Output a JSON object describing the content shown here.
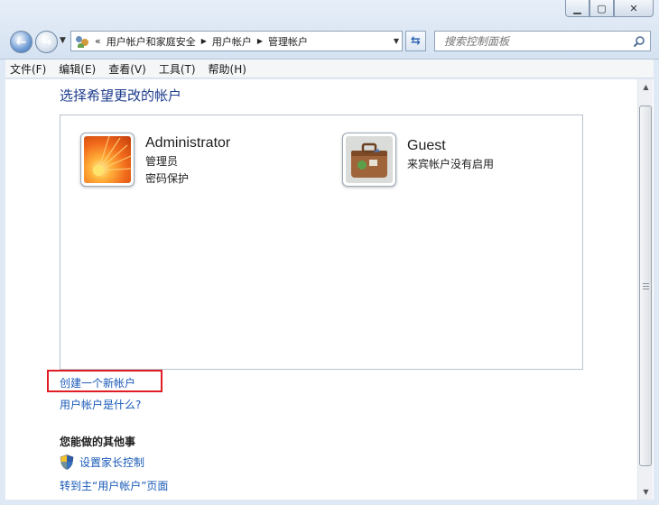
{
  "window": {
    "minimize_icon": "minimize-icon",
    "maximize_icon": "maximize-icon",
    "close_icon": "close-icon"
  },
  "nav": {
    "address_overflow": "«",
    "breadcrumb": [
      "用户帐户和家庭安全",
      "用户帐户",
      "管理帐户"
    ],
    "search_placeholder": "搜索控制面板"
  },
  "menu": [
    "文件(F)",
    "编辑(E)",
    "查看(V)",
    "工具(T)",
    "帮助(H)"
  ],
  "main": {
    "title": "选择希望更改的帐户",
    "accounts": [
      {
        "name": "Administrator",
        "line1": "管理员",
        "line2": "密码保护",
        "picture": "orange-flower"
      },
      {
        "name": "Guest",
        "line1": "来宾帐户没有启用",
        "line2": "",
        "picture": "suitcase"
      }
    ],
    "create_account": "创建一个新帐户",
    "what_is_account": "用户帐户是什么?",
    "other_heading": "您能做的其他事",
    "parental_control": "设置家长控制",
    "goto_main": "转到主“用户帐户”页面"
  },
  "colors": {
    "link": "#1a5ab8",
    "title": "#1e3c8c",
    "highlight": "#e01c24"
  }
}
